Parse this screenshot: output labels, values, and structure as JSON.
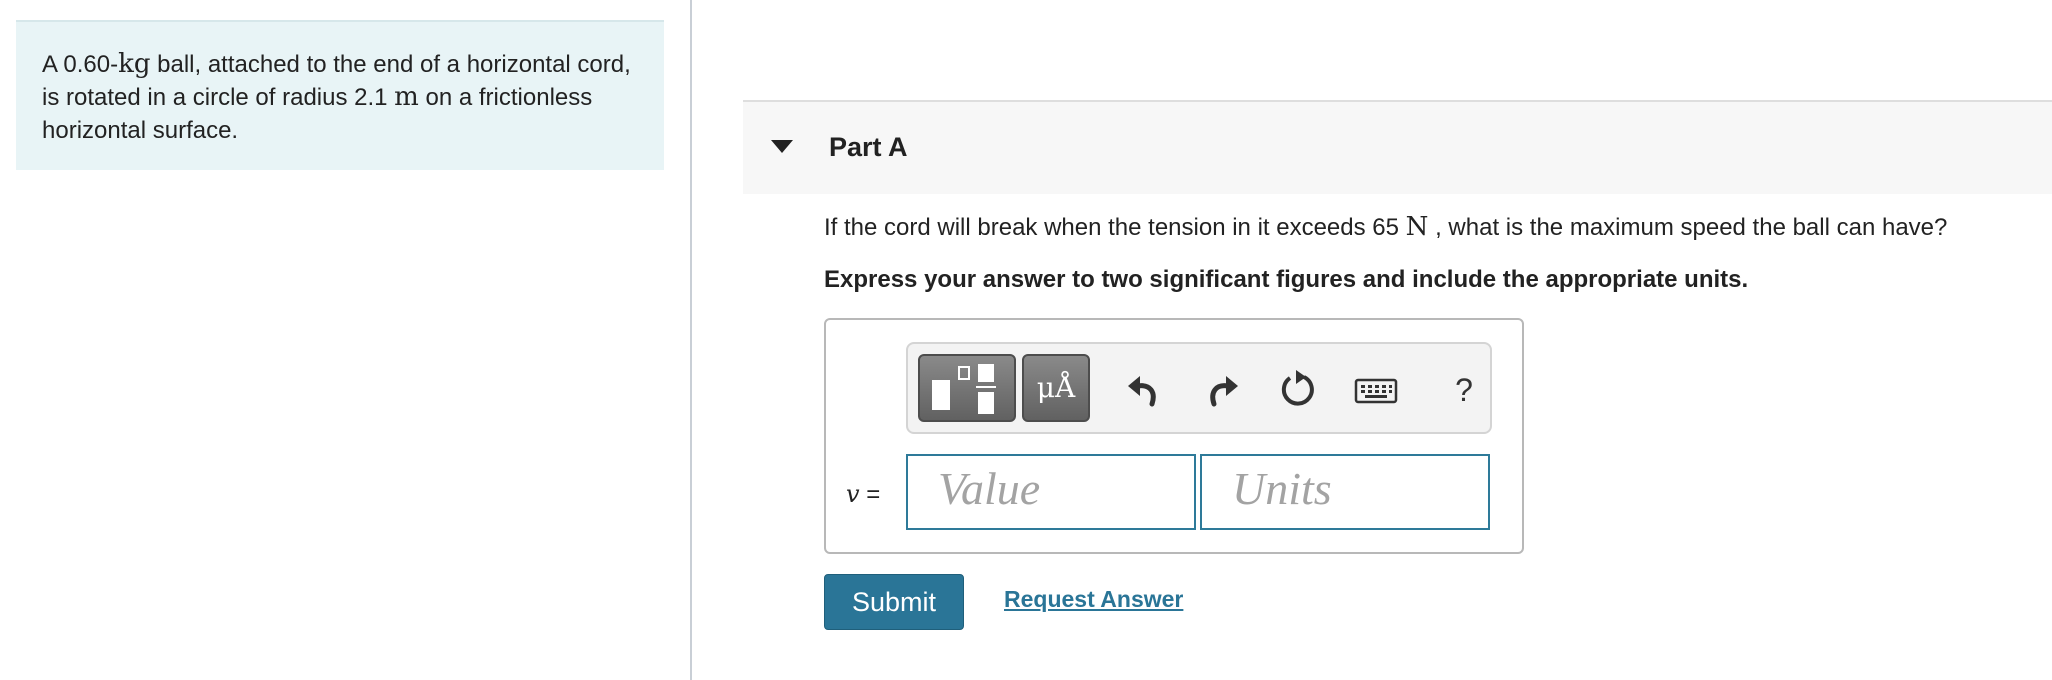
{
  "problem": {
    "segments": [
      "A 0.60-",
      "kg",
      " ball, attached to the end of a horizontal cord, is rotated in a circle of radius 2.1 ",
      "m",
      " on a frictionless horizontal surface."
    ]
  },
  "part": {
    "caret_icon": "caret-down-icon",
    "title": "Part A",
    "question_before": "If the cord will break when the tension in it exceeds 65 ",
    "question_unit": "N",
    "question_after": " , what is the maximum speed the ball can have?",
    "instruction": "Express your answer to two significant figures and include the appropriate units."
  },
  "toolbar": {
    "templates_icon": "templates-icon",
    "units_symbol": "μÅ",
    "undo_icon": "undo-icon",
    "redo_icon": "redo-icon",
    "reset_icon": "reset-icon",
    "keyboard_icon": "keyboard-icon",
    "help_label": "?"
  },
  "answer": {
    "variable": "v",
    "equals": " =",
    "value_placeholder": "Value",
    "units_placeholder": "Units"
  },
  "actions": {
    "submit_label": "Submit",
    "request_label": "Request Answer"
  },
  "colors": {
    "accent": "#2a7597",
    "problem_bg": "#e8f4f6",
    "header_bg": "#f7f7f7"
  }
}
